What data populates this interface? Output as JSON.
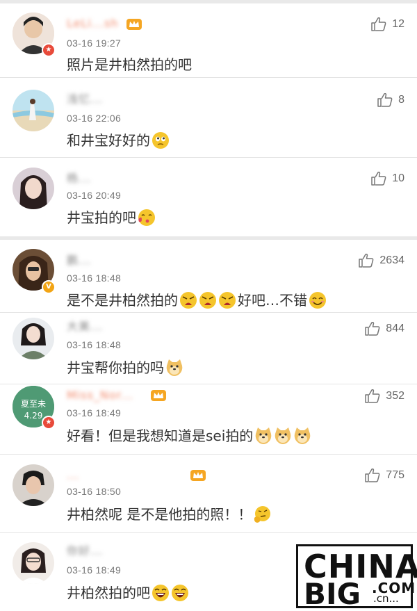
{
  "comments": [
    {
      "name": "LeLi...sh",
      "time": "03-16 19:27",
      "text": "照片是井柏然拍的吧",
      "likes": "12",
      "name_color": "#f28a6c",
      "badge": "red",
      "crown": true
    },
    {
      "name": "浅忆...",
      "time": "03-16 22:06",
      "text": "和井宝好好的",
      "likes": "8",
      "name_color": "#888888",
      "badge": "",
      "crown": false
    },
    {
      "name": "杨...",
      "time": "03-16 20:49",
      "text": "井宝拍的吧",
      "likes": "10",
      "name_color": "#888888",
      "badge": "",
      "crown": false
    },
    {
      "name": "鹏...",
      "time": "03-16 18:48",
      "text": "是不是井柏然拍的",
      "text_tail": "好吧…不错",
      "likes": "2634",
      "name_color": "#888888",
      "badge": "gold",
      "crown": false
    },
    {
      "name": "大美...",
      "time": "03-16 18:48",
      "text": "井宝帮你拍的吗",
      "likes": "844",
      "name_color": "#888888",
      "badge": "",
      "crown": false
    },
    {
      "name": "Miss_Nor...",
      "time": "03-16 18:49",
      "text": "好看！但是我想知道是sei拍的",
      "likes": "352",
      "name_color": "#f28a6c",
      "badge": "red",
      "crown": true
    },
    {
      "name": "...",
      "time": "03-16 18:50",
      "text": "井柏然呢 是不是他拍的照！！",
      "likes": "775",
      "name_color": "#f28a6c",
      "badge": "",
      "crown": true
    },
    {
      "name": "你好...",
      "time": "03-16 18:49",
      "text": "井柏然拍的吧",
      "likes": "",
      "name_color": "#888888",
      "badge": "",
      "crown": false
    }
  ],
  "avatar_texts": {
    "c6_line1": "夏至未",
    "c6_line2": "4.29"
  },
  "badges": {
    "gold_mark": "V",
    "red_mark": "★"
  },
  "watermark": {
    "line1": "CHINA",
    "line2": "BIG",
    "com": ".COM",
    "cn": ".cn..."
  },
  "colors": {
    "emoji": "#f5c52c",
    "like_icon": "#777777",
    "accent_red": "#e84a3a"
  }
}
